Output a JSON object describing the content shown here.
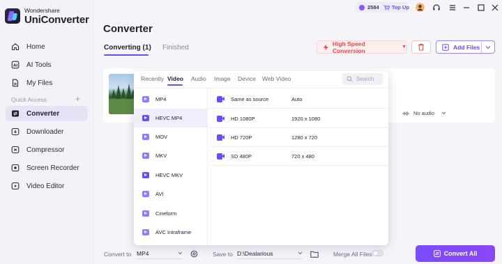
{
  "brand": {
    "sub": "Wondershare",
    "main": "UniConverter"
  },
  "nav": [
    {
      "label": "Home",
      "icon": "home-icon"
    },
    {
      "label": "AI Tools",
      "icon": "ai-icon"
    },
    {
      "label": "My Files",
      "icon": "file-icon"
    },
    {
      "label": "Converter",
      "icon": "convert-icon",
      "active": true
    },
    {
      "label": "Downloader",
      "icon": "download-icon"
    },
    {
      "label": "Compressor",
      "icon": "compress-icon"
    },
    {
      "label": "Screen Recorder",
      "icon": "record-icon"
    },
    {
      "label": "Video Editor",
      "icon": "video-editor-icon"
    }
  ],
  "section_label": "Quick Access",
  "topbar": {
    "points": "2584",
    "topup": "Top Up"
  },
  "page_title": "Converter",
  "tabs": {
    "converting": "Converting (1)",
    "finished": "Finished"
  },
  "toolbar": {
    "high_speed": "High Speed Conversion",
    "add_files": "Add Files"
  },
  "card": {
    "audio": "No audio"
  },
  "popup": {
    "tabs": [
      "Recently",
      "Video",
      "Audio",
      "Image",
      "Device",
      "Web Video"
    ],
    "active_tab": "Video",
    "search_placeholder": "Search",
    "formats": [
      "MP4",
      "HEVC MP4",
      "MOV",
      "MKV",
      "HEVC MKV",
      "AVI",
      "Cineform",
      "AVC Intraframe"
    ],
    "selected_format": "HEVC MP4",
    "resolutions": [
      {
        "name": "Same as source",
        "value": "Auto"
      },
      {
        "name": "HD 1080P",
        "value": "1920 x 1080"
      },
      {
        "name": "HD 720P",
        "value": "1280 x 720"
      },
      {
        "name": "SD 480P",
        "value": "720 x 480"
      }
    ]
  },
  "bottom": {
    "convert_to_label": "Convert to",
    "convert_to_value": "MP4",
    "save_to_label": "Save to",
    "save_to_value": "D:\\Dealarious",
    "merge_label": "Merge All Files",
    "convert_all": "Convert All"
  },
  "colors": {
    "accent": "#6a4cff",
    "danger": "#e5484d",
    "convert_gradient": "#7a4dff"
  }
}
